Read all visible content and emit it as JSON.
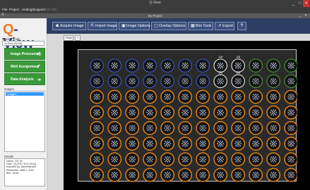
{
  "window": {
    "title": "Q-View",
    "controls": [
      "_",
      "□",
      "✕"
    ]
  },
  "menu": {
    "items": [
      {
        "label": "File",
        "dim": false
      },
      {
        "label": "Project",
        "dim": false
      },
      {
        "label": "Settings",
        "dim": false
      },
      {
        "label": "Support",
        "dim": false
      },
      {
        "label": "Dev Ctrl",
        "dim": true
      }
    ]
  },
  "project_bar": {
    "title": "My Project",
    "left_icon": "≡",
    "right_controls": [
      "_",
      "✕"
    ]
  },
  "sidebar": {
    "logo_q": "Q",
    "logo_rest": "-View",
    "product_code_label": "Product Code",
    "product_code_value": "Ni Red (W/48)",
    "steps": [
      {
        "label": "Image Processing",
        "icon": "✓"
      },
      {
        "label": "Well Assignment",
        "icon": "✓"
      },
      {
        "label": "Data Analysis",
        "icon": "➔"
      }
    ],
    "images_label": "Images",
    "images_selected": "Image1",
    "details_label": "Details",
    "details_lines": [
      "Name: 701 Ini",
      "Date: 2/1/2017 8:21:29 Ag",
      "Imported by: Administrator",
      "Resolution: 2880 x 2162",
      "Bits: 16-bit"
    ]
  },
  "toolbar": {
    "buttons": [
      {
        "label": "Acquire Image",
        "icon": "camera-icon",
        "glyph": "◙"
      },
      {
        "label": "Import Image",
        "icon": "import-icon",
        "glyph": "⇱"
      },
      {
        "label": "Image Options",
        "icon": "image-icon",
        "glyph": "▣"
      },
      {
        "label": "Overlay Options",
        "icon": "overlay-icon",
        "glyph": "▢"
      },
      {
        "label": "Blot Tools",
        "icon": "grid-icon",
        "glyph": "▦"
      },
      {
        "label": "Export",
        "icon": "export-icon",
        "glyph": "⇗"
      },
      {
        "label": "?",
        "icon": "help-icon",
        "glyph": ""
      }
    ]
  },
  "tabs": [
    {
      "label": "Plate 1"
    },
    {
      "label": "+"
    }
  ],
  "plate": {
    "rows": 8,
    "cols": 12,
    "row1_labels": [
      "",
      "",
      "",
      "",
      "",
      "",
      "",
      "A8",
      "A9",
      "",
      "",
      ""
    ],
    "row2_labels": [
      "",
      "",
      "",
      "",
      "",
      "",
      "",
      "B8",
      "B9",
      "",
      "",
      ""
    ],
    "colors": {
      "blue_ring": "#3f59c8",
      "white_ring": "#e8e8e8",
      "green_ring": "#4c9a3a",
      "orange_ring": "#e0821a",
      "well_fill": "#141414",
      "spot": "#c8d4ea"
    },
    "row_ring_types": [
      [
        "blue",
        "blue",
        "blue",
        "blue",
        "blue",
        "blue",
        "blue",
        "white",
        "white",
        "green",
        "green",
        "green"
      ],
      [
        "blue",
        "blue",
        "blue",
        "blue",
        "blue",
        "blue",
        "blue",
        "white",
        "white",
        "green",
        "green",
        "green"
      ],
      [
        "orange",
        "orange",
        "orange",
        "orange",
        "orange",
        "orange",
        "orange",
        "orange",
        "orange",
        "orange",
        "orange",
        "orange"
      ],
      [
        "orange",
        "orange",
        "orange",
        "orange",
        "orange",
        "orange",
        "orange",
        "orange",
        "orange",
        "orange",
        "orange",
        "orange"
      ],
      [
        "orange",
        "orange",
        "orange",
        "orange",
        "orange",
        "orange",
        "orange",
        "orange",
        "orange",
        "orange",
        "orange",
        "orange"
      ],
      [
        "orange",
        "orange",
        "orange",
        "orange",
        "orange",
        "orange",
        "orange",
        "orange",
        "orange",
        "orange",
        "orange",
        "orange"
      ],
      [
        "orange",
        "orange",
        "orange",
        "orange",
        "orange",
        "orange",
        "orange",
        "orange",
        "orange",
        "orange",
        "orange",
        "orange"
      ],
      [
        "orange",
        "orange",
        "orange",
        "orange",
        "orange",
        "orange",
        "orange",
        "orange",
        "orange",
        "orange",
        "orange",
        "orange"
      ]
    ]
  }
}
